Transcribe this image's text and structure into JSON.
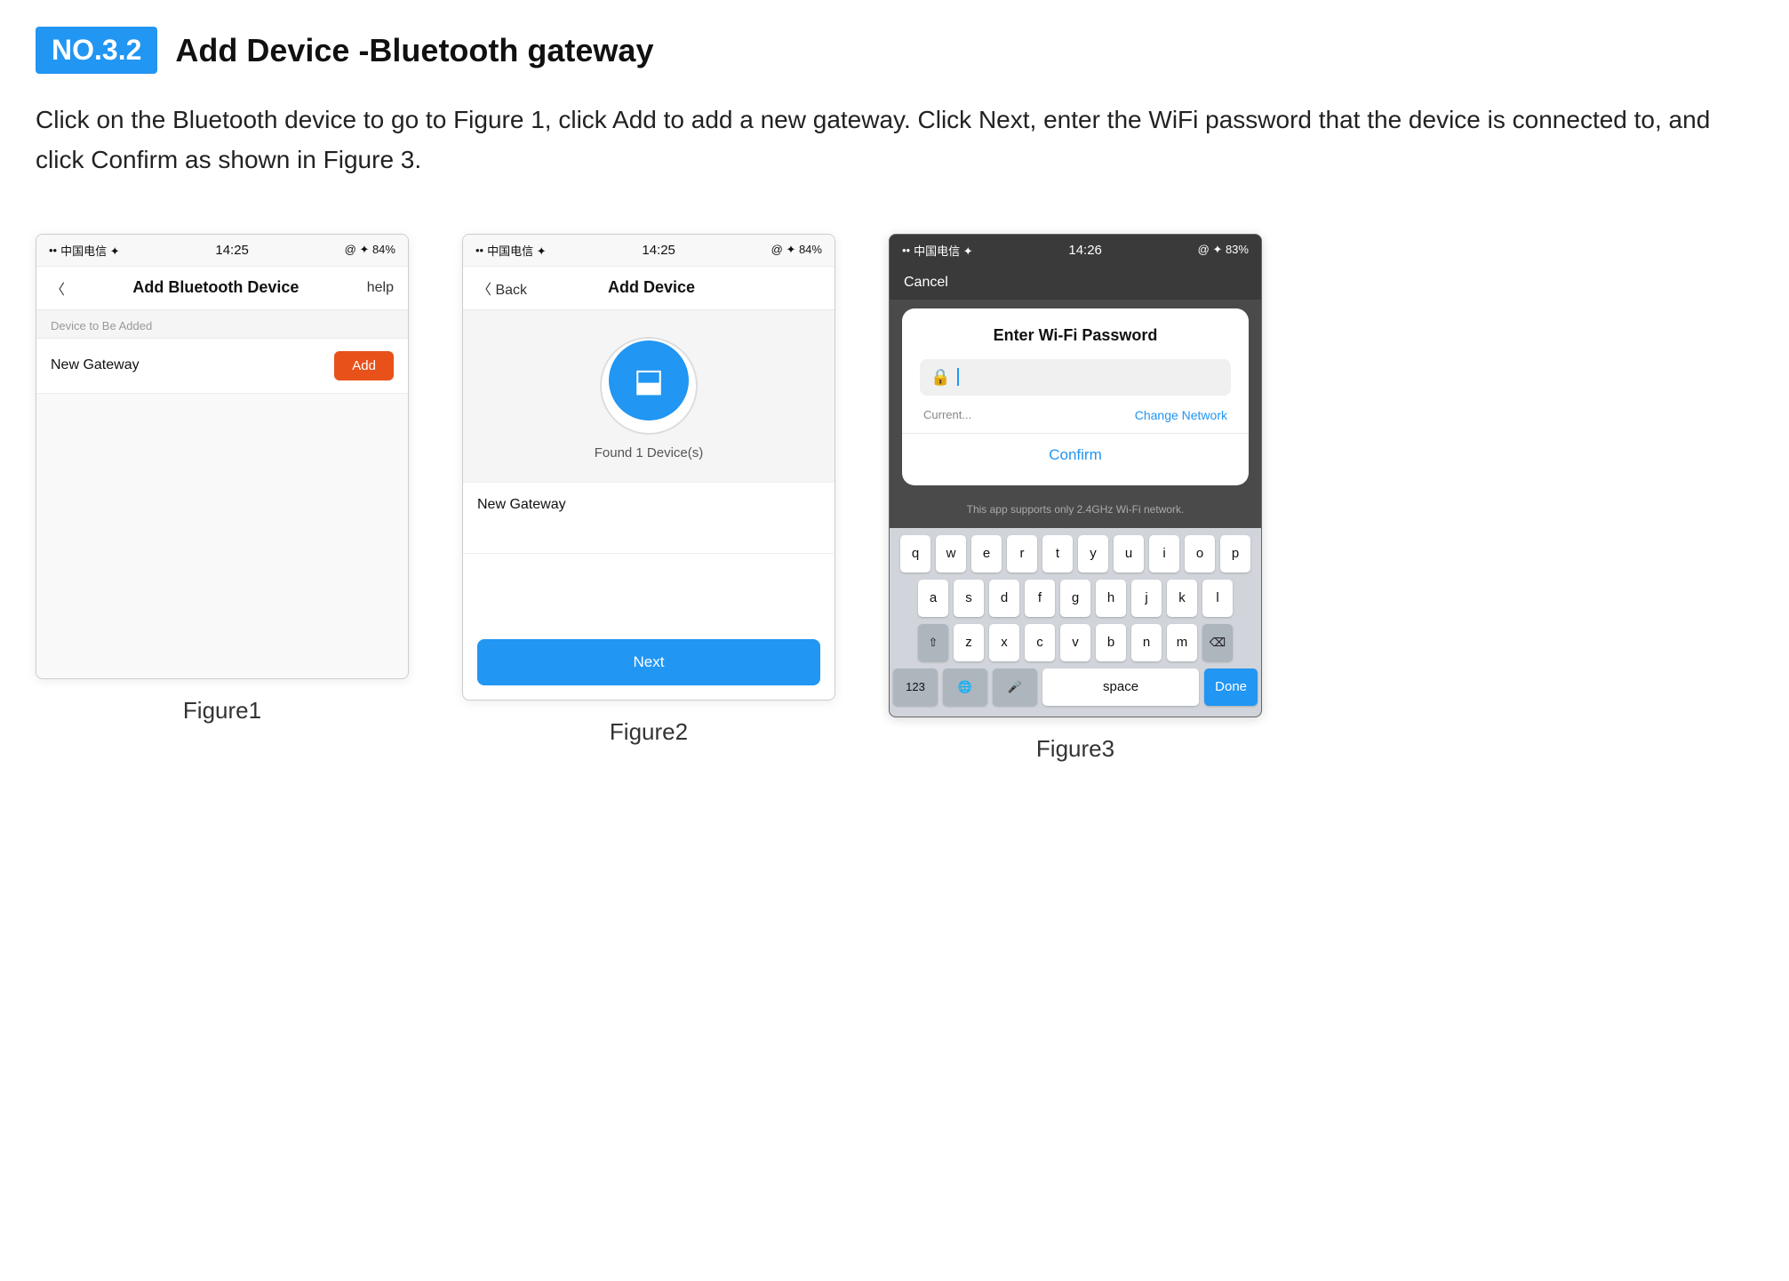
{
  "header": {
    "badge": "NO.3.2",
    "title": "Add Device -Bluetooth gateway"
  },
  "description": "Click on the Bluetooth device to go to Figure 1, click Add to add a new gateway. Click Next, enter the WiFi password that the device is connected to, and click Confirm as shown in Figure 3.",
  "figure1": {
    "label": "Figure1",
    "status_left": "中国电信 ✦",
    "status_time": "14:25",
    "status_right": "@ ✦ 84%",
    "nav_back": "〈",
    "nav_title": "Add Bluetooth Device",
    "nav_help": "help",
    "section_label": "Device to Be Added",
    "device_name": "New Gateway",
    "add_btn": "Add"
  },
  "figure2": {
    "label": "Figure2",
    "status_left": "中国电信 ✦",
    "status_time": "14:25",
    "status_right": "@ ✦ 84%",
    "nav_back": "〈 Back",
    "nav_title": "Add Device",
    "found_text": "Found 1 Device(s)",
    "device_name": "New Gateway",
    "next_btn": "Next"
  },
  "figure3": {
    "label": "Figure3",
    "status_left": "中国电信 ✦",
    "status_time": "14:26",
    "status_right": "@ ✦ 83%",
    "cancel": "Cancel",
    "modal_title": "Enter Wi-Fi Password",
    "current_text": "Current...",
    "change_network": "Change Network",
    "confirm_btn": "Confirm",
    "wifi_note": "This app supports only 2.4GHz Wi-Fi network.",
    "keyboard": {
      "row1": [
        "q",
        "w",
        "e",
        "r",
        "t",
        "y",
        "u",
        "i",
        "o",
        "p"
      ],
      "row2": [
        "a",
        "s",
        "d",
        "f",
        "g",
        "h",
        "j",
        "k",
        "l"
      ],
      "row3": [
        "z",
        "x",
        "c",
        "v",
        "b",
        "n",
        "m"
      ],
      "num_key": "123",
      "space_key": "space",
      "done_key": "Done"
    }
  }
}
